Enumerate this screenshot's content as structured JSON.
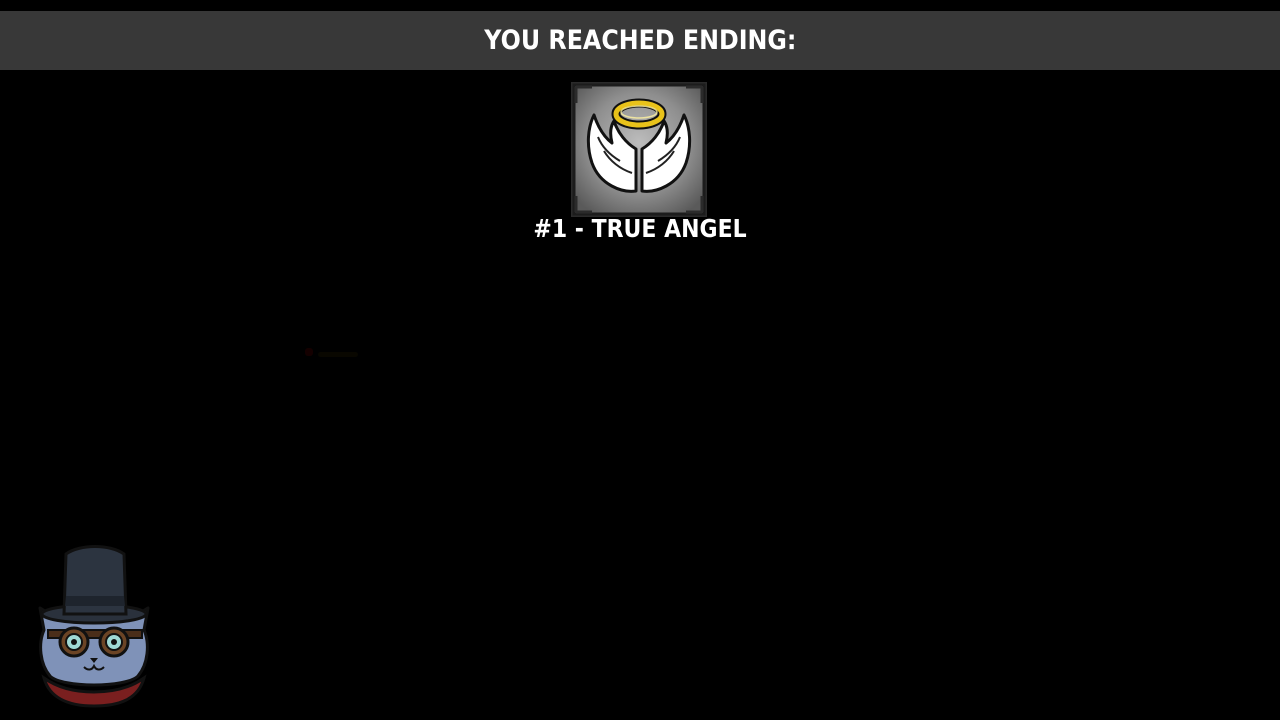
{
  "banner": {
    "title": "YOU REACHED ENDING:"
  },
  "ending": {
    "name": "#1 - TRUE ANGEL",
    "icon": "angel-wings-halo-icon"
  },
  "mascot": {
    "icon": "top-hat-cat-goggles-mascot"
  },
  "colors": {
    "background": "#000000",
    "banner": "#383838",
    "text": "#ffffff",
    "halo": "#e8c21a"
  }
}
